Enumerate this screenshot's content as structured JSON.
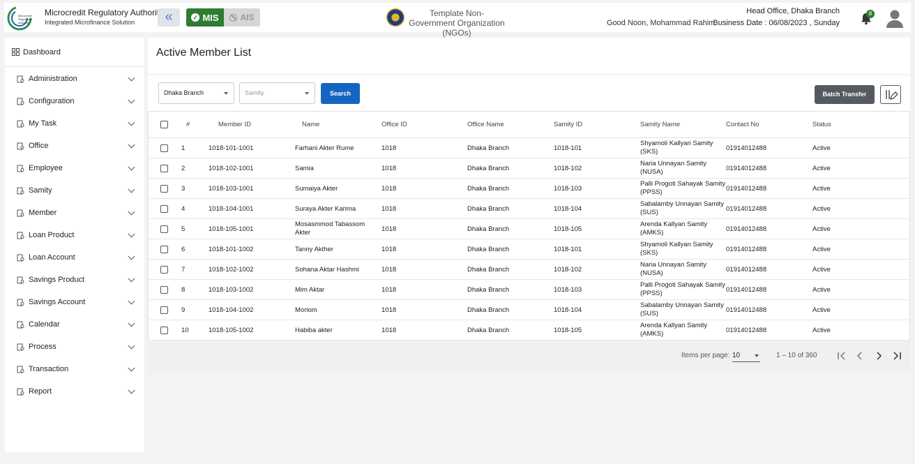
{
  "header": {
    "brand_title": "Microcredit Regulatory Authority",
    "brand_subtitle": "Integrated Microfinance Solution",
    "logo_text": "Microcredit Regulatory Authority",
    "mis_label": "MIS",
    "ais_label": "AIS",
    "org_name": "Template Non-Government Organization (NGOs)",
    "greeting": "Good Noon, Mohammad Rahim",
    "office": "Head Office, Dhaka Branch",
    "business_date": "Business Date : 06/08/2023 , Sunday",
    "notification_count": "8",
    "icons": {
      "collapse": "double-chevron-left-icon",
      "bell": "bell-icon",
      "avatar": "user-avatar-icon"
    }
  },
  "sidebar": {
    "dashboard_label": "Dashboard",
    "items": [
      {
        "label": "Administration",
        "icon": "admin-icon"
      },
      {
        "label": "Configuration",
        "icon": "config-icon"
      },
      {
        "label": "My Task",
        "icon": "task-icon"
      },
      {
        "label": "Office",
        "icon": "office-icon"
      },
      {
        "label": "Employee",
        "icon": "employee-icon"
      },
      {
        "label": "Samity",
        "icon": "samity-icon"
      },
      {
        "label": "Member",
        "icon": "member-icon"
      },
      {
        "label": "Loan Product",
        "icon": "loan-product-icon"
      },
      {
        "label": "Loan Account",
        "icon": "loan-account-icon"
      },
      {
        "label": "Savings Product",
        "icon": "savings-product-icon"
      },
      {
        "label": "Savings Account",
        "icon": "savings-account-icon"
      },
      {
        "label": "Calendar",
        "icon": "calendar-icon"
      },
      {
        "label": "Process",
        "icon": "process-icon"
      },
      {
        "label": "Transaction",
        "icon": "transaction-icon"
      },
      {
        "label": "Report",
        "icon": "report-icon"
      }
    ]
  },
  "main": {
    "title": "Active Member List",
    "filters": {
      "branch_value": "Dhaka Branch",
      "samity_placeholder": "Samity",
      "search_label": "Search",
      "batch_transfer_label": "Batch Transfer"
    },
    "table": {
      "columns": [
        "#",
        "Member ID",
        "Name",
        "Office ID",
        "Office Name",
        "Samity ID",
        "Samity Name",
        "Contact No",
        "Status"
      ],
      "rows": [
        {
          "no": "1",
          "member_id": "1018-101-1001",
          "name": "Farhani Akter Rume",
          "office_id": "1018",
          "office_name": "Dhaka Branch",
          "samity_id": "1018-101",
          "samity_name": "Shyamoli Kallyan Samity (SKS)",
          "contact": "01914012488",
          "status": "Active"
        },
        {
          "no": "2",
          "member_id": "1018-102-1001",
          "name": "Samia",
          "office_id": "1018",
          "office_name": "Dhaka Branch",
          "samity_id": "1018-102",
          "samity_name": "Naria Unnayan Samity (NUSA)",
          "contact": "01914012488",
          "status": "Active"
        },
        {
          "no": "3",
          "member_id": "1018-103-1001",
          "name": "Sumaiya Akter",
          "office_id": "1018",
          "office_name": "Dhaka Branch",
          "samity_id": "1018-103",
          "samity_name": "Palli Progoti Sahayak Samity (PPSS)",
          "contact": "01914012488",
          "status": "Active"
        },
        {
          "no": "4",
          "member_id": "1018-104-1001",
          "name": "Suraya Akter Karima",
          "office_id": "1018",
          "office_name": "Dhaka Branch",
          "samity_id": "1018-104",
          "samity_name": "Sabalamby Unnayan Samity (SUS)",
          "contact": "01914012488",
          "status": "Active"
        },
        {
          "no": "5",
          "member_id": "1018-105-1001",
          "name": "Mosasmmod Tabassom Akter",
          "office_id": "1018",
          "office_name": "Dhaka Branch",
          "samity_id": "1018-105",
          "samity_name": "Arenda Kallyan Samity (AMKS)",
          "contact": "01914012488",
          "status": "Active"
        },
        {
          "no": "6",
          "member_id": "1018-101-1002",
          "name": "Tanny Akther",
          "office_id": "1018",
          "office_name": "Dhaka Branch",
          "samity_id": "1018-101",
          "samity_name": "Shyamoli Kallyan Samity (SKS)",
          "contact": "01914012488",
          "status": "Active"
        },
        {
          "no": "7",
          "member_id": "1018-102-1002",
          "name": "Sohana Aktar Hashmi",
          "office_id": "1018",
          "office_name": "Dhaka Branch",
          "samity_id": "1018-102",
          "samity_name": "Naria Unnayan Samity (NUSA)",
          "contact": "01914012488",
          "status": "Active"
        },
        {
          "no": "8",
          "member_id": "1018-103-1002",
          "name": "Mim Aktar",
          "office_id": "1018",
          "office_name": "Dhaka Branch",
          "samity_id": "1018-103",
          "samity_name": "Palli Progoti Sahayak Samity (PPSS)",
          "contact": "01914012488",
          "status": "Active"
        },
        {
          "no": "9",
          "member_id": "1018-104-1002",
          "name": "Moriom",
          "office_id": "1018",
          "office_name": "Dhaka Branch",
          "samity_id": "1018-104",
          "samity_name": "Sabalamby Unnayan Samity (SUS)",
          "contact": "01914012488",
          "status": "Active"
        },
        {
          "no": "10",
          "member_id": "1018-105-1002",
          "name": "Habiba akter",
          "office_id": "1018",
          "office_name": "Dhaka Branch",
          "samity_id": "1018-105",
          "samity_name": "Arenda Kallyan Samity (AMKS)",
          "contact": "01914012488",
          "status": "Active"
        }
      ]
    },
    "paginator": {
      "items_per_page_label": "Items per page:",
      "items_per_page_value": "10",
      "range_label": "1 – 10 of 360"
    }
  },
  "colors": {
    "mis_green": "#2e7d32",
    "search_blue": "#1565c0",
    "batch_gray": "#555a60"
  }
}
